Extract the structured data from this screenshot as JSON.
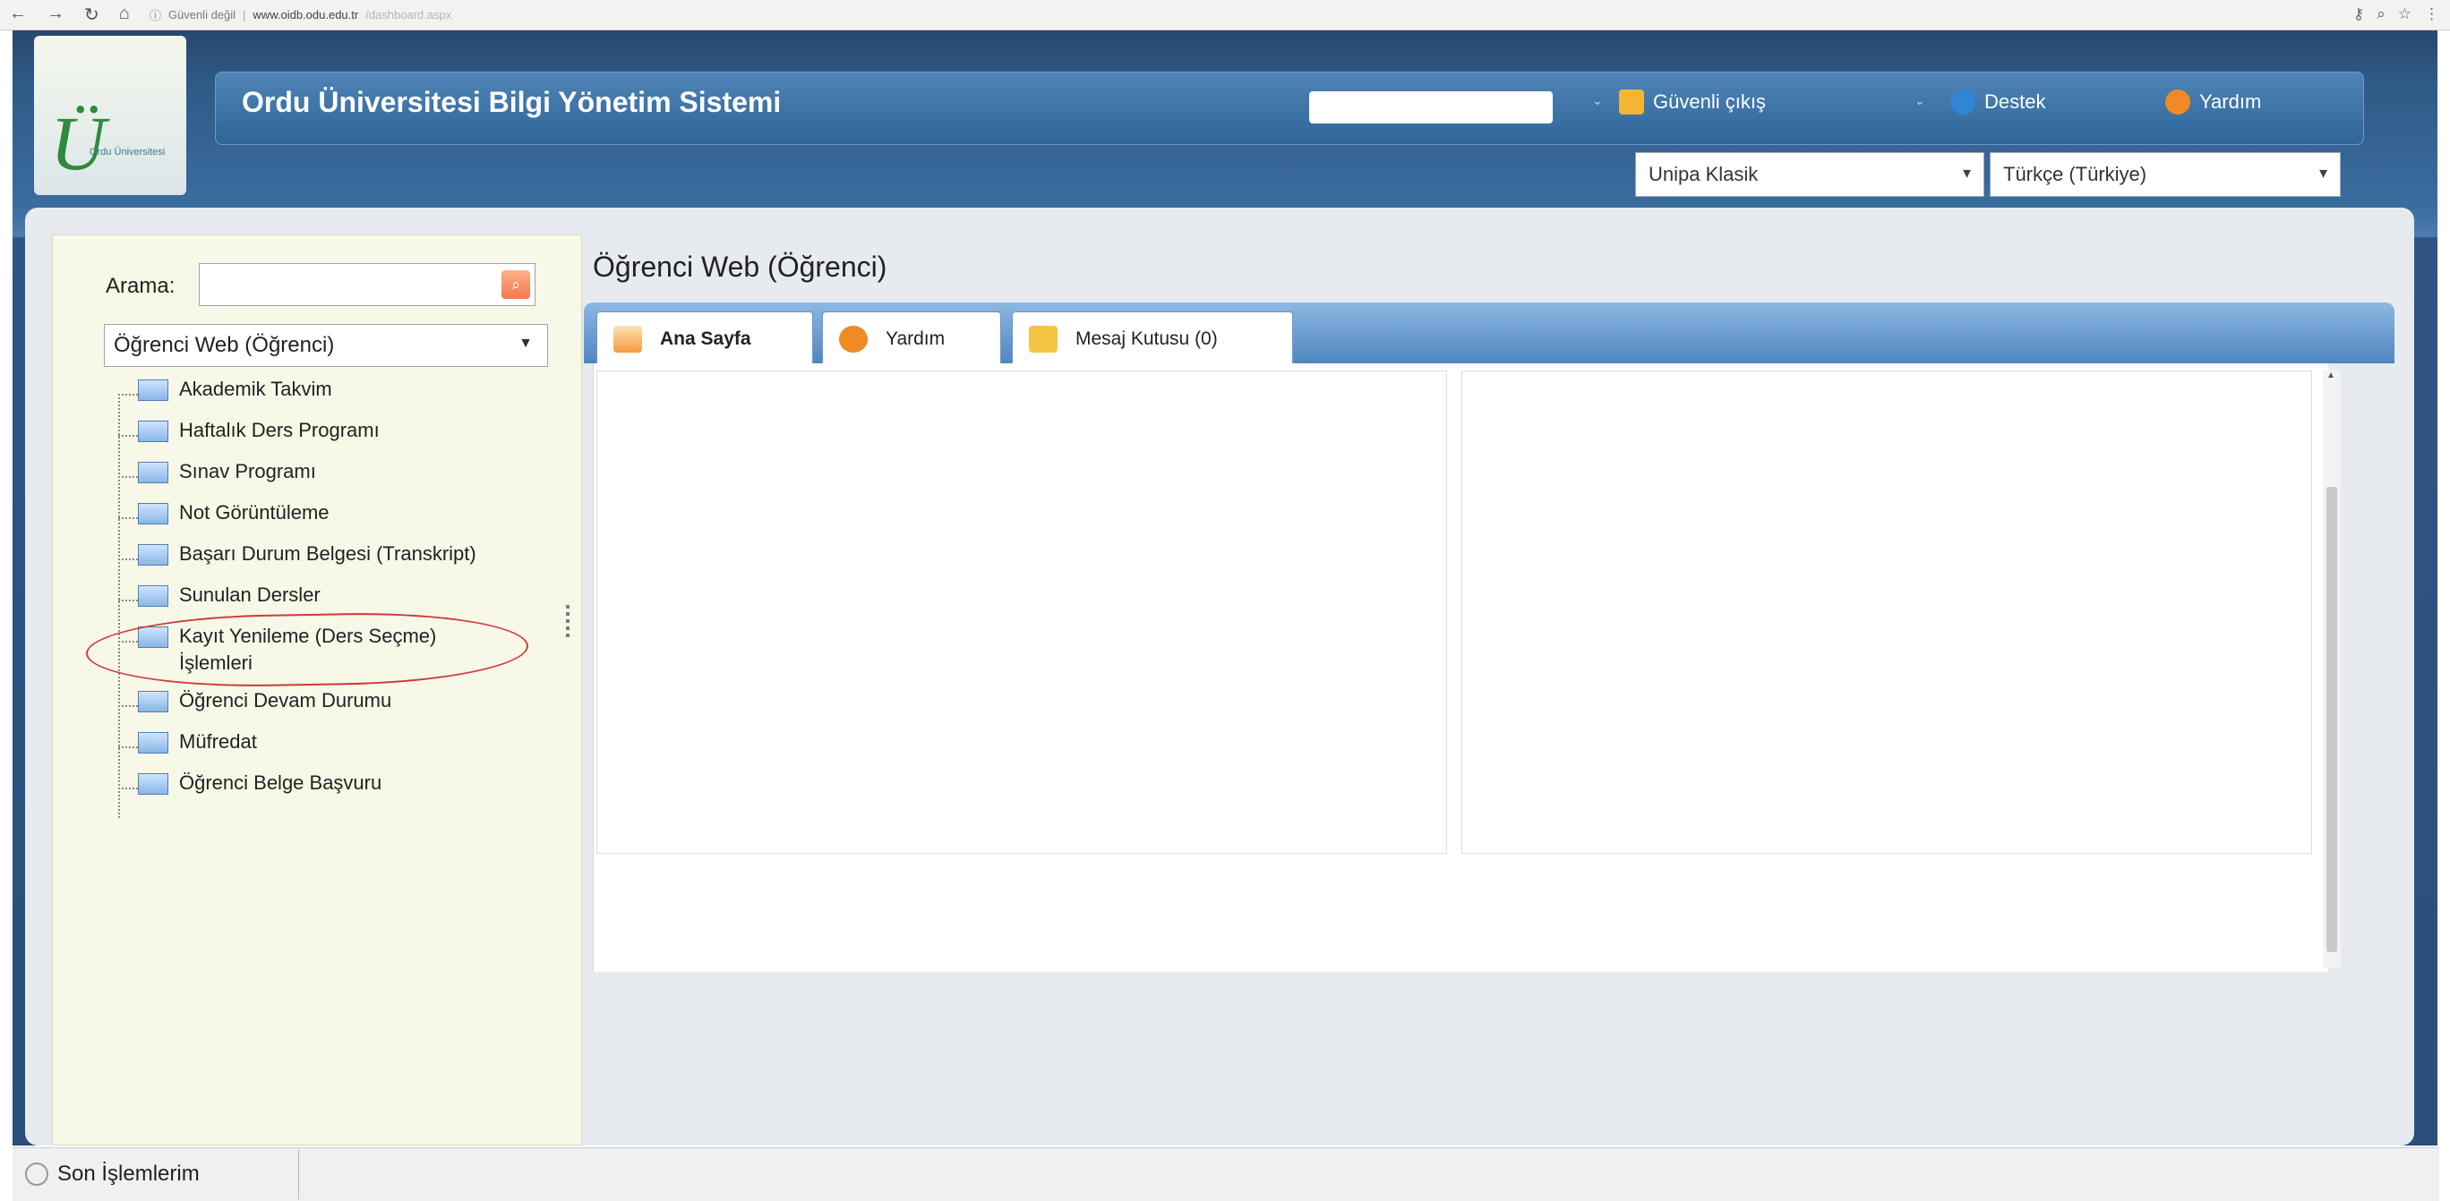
{
  "browser": {
    "nav_icons": [
      "back-icon",
      "forward-icon",
      "reload-icon",
      "home-icon"
    ],
    "security_text": "Güvenli değil",
    "url": "www.oidb.odu.edu.tr",
    "url_path": "/dashboard.aspx",
    "right_icons": [
      "key-icon",
      "zoom-icon",
      "star-icon",
      "menu-icon"
    ]
  },
  "header": {
    "logo_text": "Ordu Üniversitesi",
    "site_title": "Ordu Üniversitesi Bilgi Yönetim Sistemi",
    "menu": [
      {
        "label": "Güvenli çıkış",
        "icon": "lock-icon",
        "color": "#f2b632"
      },
      {
        "label": "Destek",
        "icon": "info-icon",
        "color": "#2f86d6"
      },
      {
        "label": "Yardım",
        "icon": "help-icon",
        "color": "#f08a24"
      }
    ],
    "theme_select": {
      "value": "Unipa Klasik"
    },
    "language_select": {
      "value": "Türkçe (Türkiye)"
    }
  },
  "sidebar": {
    "search_label": "Arama:",
    "search_value": "",
    "module_select": "Öğrenci Web (Öğrenci)",
    "items": [
      {
        "label": "Akademik Takvim"
      },
      {
        "label": "Haftalık Ders Programı"
      },
      {
        "label": "Sınav Programı"
      },
      {
        "label": "Not Görüntüleme"
      },
      {
        "label": "Başarı Durum Belgesi (Transkript)"
      },
      {
        "label": "Sunulan Dersler"
      },
      {
        "label": "Kayıt Yenileme (Ders Seçme)",
        "label2": "İşlemleri",
        "highlighted": true
      },
      {
        "label": "Öğrenci Devam Durumu"
      },
      {
        "label": "Müfredat"
      },
      {
        "label": "Öğrenci Belge Başvuru"
      }
    ]
  },
  "content": {
    "title": "Öğrenci Web (Öğrenci)",
    "tabs": [
      {
        "label": "Ana Sayfa",
        "icon": "home-icon",
        "active": true
      },
      {
        "label": "Yardım",
        "icon": "help-icon",
        "active": false
      },
      {
        "label": "Mesaj Kutusu (0)",
        "icon": "mail-icon",
        "active": false
      }
    ]
  },
  "footer": {
    "recent_label": "Son İşlemlerim"
  },
  "colors": {
    "header_blue": "#2f5a88",
    "highlight_circle": "#cf3a3a",
    "sidebar_bg": "#f7f8e8"
  }
}
